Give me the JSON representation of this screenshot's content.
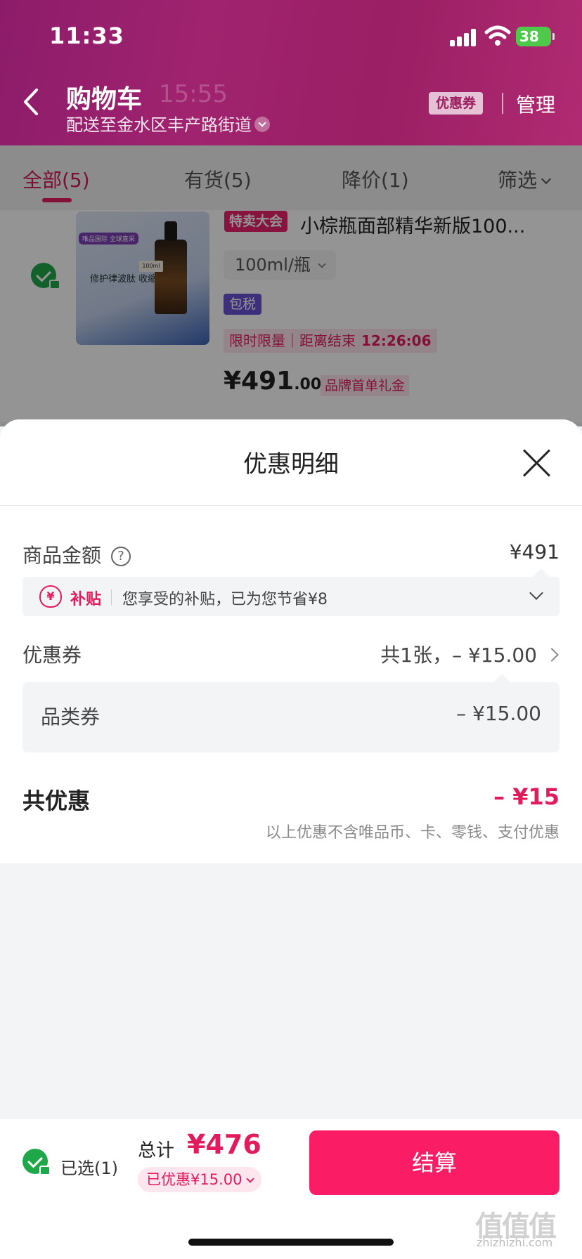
{
  "status": {
    "time": "11:33",
    "battery": "38"
  },
  "header": {
    "title": "购物车",
    "timer": "15:55",
    "address": "配送至金水区丰产路街道",
    "coupon_chip": "优惠券",
    "manage": "管理"
  },
  "tabs": [
    {
      "label": "全部(5)"
    },
    {
      "label": "有货(5)"
    },
    {
      "label": "降价(1)"
    },
    {
      "label": "筛选"
    }
  ],
  "item": {
    "thumb_tag": "唯品国际 全球直采",
    "thumb_text": "修护律波肽 收缩毛孔",
    "thumb_size": "100ml",
    "promo_tag": "特卖大会",
    "name": "小棕瓶面部精华新版100...",
    "spec": "100ml/瓶",
    "tax_tag": "包税",
    "limit_label": "限时限量｜距离结束",
    "limit_countdown": "12:26:06",
    "price_int": "¥491",
    "price_dec": ".00",
    "gift_tag": "品牌首单礼金"
  },
  "sheet": {
    "title": "优惠明细",
    "goods_label": "商品金额",
    "help_glyph": "?",
    "goods_value": "¥491",
    "subsidy_icon": "¥",
    "subsidy_tag": "补贴",
    "subsidy_text": "您享受的补贴，已为您节省¥8",
    "coupon_label": "优惠券",
    "coupon_value": "共1张，– ¥15.00",
    "category_label": "品类券",
    "category_value": "– ¥15.00",
    "total_label": "共优惠",
    "total_value": "– ¥15",
    "note": "以上优惠不含唯品币、卡、零钱、支付优惠"
  },
  "bottom": {
    "selected": "已选(1)",
    "total_label": "总计",
    "total_value": "¥476",
    "saved": "已优惠¥15.00",
    "pay": "结算"
  },
  "watermark": {
    "mark": "值值值",
    "url": "zhizhizhi.com"
  },
  "colors": {
    "accent": "#e21c5c",
    "pay": "#fa1c64",
    "check": "#1fa84a",
    "header": "#9a1f64"
  }
}
